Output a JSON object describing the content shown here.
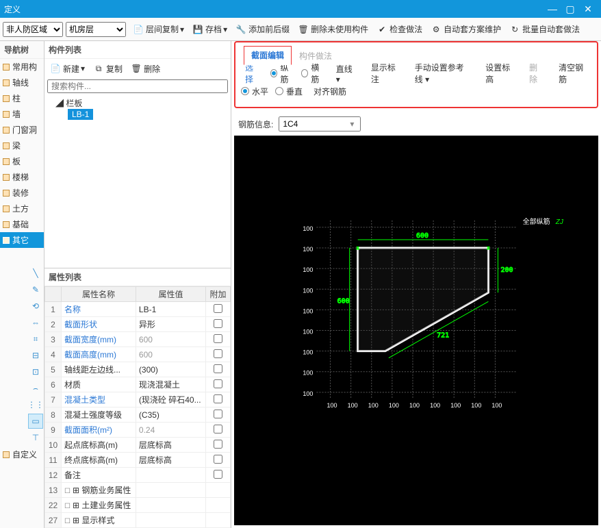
{
  "window": {
    "title": "定义"
  },
  "toolbar": {
    "sel1": "非人防区域",
    "sel2": "机房层",
    "copy_floor": "层间复制",
    "archive": "存档",
    "add_prefix": "添加前后缀",
    "del_unused": "删除未使用构件",
    "check_method": "检查做法",
    "auto_maintain": "自动套方案维护",
    "batch_auto": "批量自动套做法"
  },
  "navtree": {
    "title": "导航树",
    "items": [
      "常用构",
      "轴线",
      "柱",
      "墙",
      "门窗洞",
      "梁",
      "板",
      "楼梯",
      "装修",
      "土方",
      "基础",
      "其它"
    ],
    "bottom_item": "自定义",
    "selected_index": 11
  },
  "component_list": {
    "title": "构件列表",
    "new": "新建",
    "copy": "复制",
    "delete": "删除",
    "search_placeholder": "搜索构件...",
    "tree_l1": "栏板",
    "tree_l2": "LB-1"
  },
  "property_list": {
    "title": "属性列表",
    "columns": [
      "",
      "属性名称",
      "属性值",
      "附加"
    ],
    "rows": [
      {
        "n": "1",
        "name": "名称",
        "val": "LB-1",
        "link": true
      },
      {
        "n": "2",
        "name": "截面形状",
        "val": "异形",
        "link": true
      },
      {
        "n": "3",
        "name": "截面宽度(mm)",
        "val": "600",
        "grey": true,
        "link": true
      },
      {
        "n": "4",
        "name": "截面高度(mm)",
        "val": "600",
        "grey": true,
        "link": true
      },
      {
        "n": "5",
        "name": "轴线距左边线...",
        "val": "(300)"
      },
      {
        "n": "6",
        "name": "材质",
        "val": "现浇混凝土"
      },
      {
        "n": "7",
        "name": "混凝土类型",
        "val": "(现浇砼 碎石40...",
        "link": true
      },
      {
        "n": "8",
        "name": "混凝土强度等级",
        "val": "(C35)"
      },
      {
        "n": "9",
        "name": "截面面积(m²)",
        "val": "0.24",
        "grey": true,
        "link": true
      },
      {
        "n": "10",
        "name": "起点底标高(m)",
        "val": "层底标高"
      },
      {
        "n": "11",
        "name": "终点底标高(m)",
        "val": "层底标高"
      },
      {
        "n": "12",
        "name": "备注",
        "val": ""
      },
      {
        "n": "13",
        "name": "钢筋业务属性",
        "exp": true
      },
      {
        "n": "22",
        "name": "土建业务属性",
        "exp": true
      },
      {
        "n": "27",
        "name": "显示样式",
        "exp": true
      }
    ]
  },
  "tabs": {
    "t1": "截面编辑",
    "t2": "构件做法"
  },
  "edit_row1": {
    "select": "选择",
    "v": "纵筋",
    "h": "横筋",
    "line": "直线",
    "show_mark": "显示标注",
    "manual_ref": "手动设置参考线",
    "set_elev": "设置标高",
    "del": "删除",
    "clear": "清空钢筋"
  },
  "edit_row2": {
    "horiz": "水平",
    "vert": "垂直",
    "align": "对齐钢筋"
  },
  "steel": {
    "label": "钢筋信息:",
    "value": "1C4"
  },
  "canvas": {
    "legend": "全部纵筋",
    "legend2": "ZJ",
    "top_dim": "600",
    "right_dim": "200",
    "left_dim": "600",
    "bottom_dim": "721",
    "x_ticks": [
      "100",
      "100",
      "100",
      "100",
      "100",
      "100",
      "100",
      "100",
      "100"
    ],
    "y_ticks": [
      "100",
      "100",
      "100",
      "100",
      "100",
      "100",
      "100",
      "100",
      "100"
    ]
  }
}
